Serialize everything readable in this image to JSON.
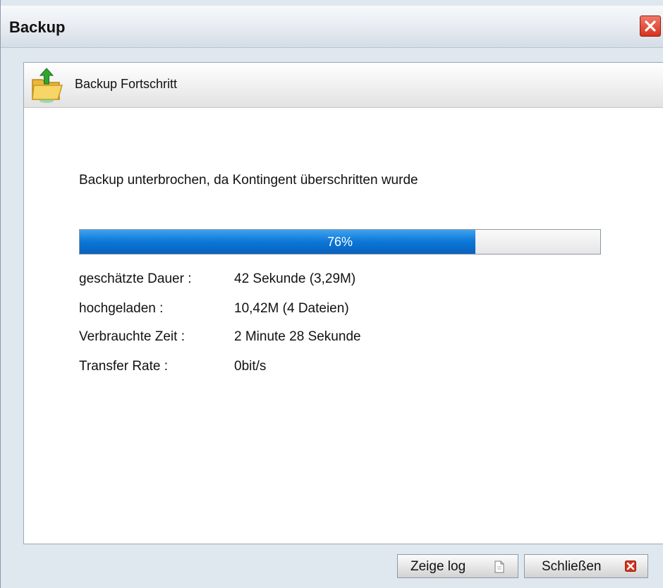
{
  "window": {
    "title": "Backup",
    "close_icon": "close-icon"
  },
  "panel": {
    "header": {
      "icon": "folder-upload-icon",
      "title": "Backup Fortschritt"
    },
    "message": "Backup unterbrochen, da Kontingent überschritten wurde",
    "progress": {
      "percent": 76,
      "label": "76%",
      "fill_color": "#0b76d8"
    },
    "info": {
      "estimated_duration": {
        "label": "geschätzte Dauer :",
        "value": "42 Sekunde (3,29M)"
      },
      "uploaded": {
        "label": "hochgeladen :",
        "value": "10,42M (4 Dateien)"
      },
      "elapsed_time": {
        "label": "Verbrauchte Zeit :",
        "value": "2 Minute 28 Sekunde"
      },
      "transfer_rate": {
        "label": "Transfer Rate :",
        "value": "0bit/s"
      }
    }
  },
  "buttons": {
    "show_log": {
      "label": "Zeige log",
      "icon": "document-icon"
    },
    "close": {
      "label": "Schließen",
      "icon": "close-red-icon"
    }
  },
  "colors": {
    "accent": "#0b76d8",
    "close_red": "#d8321d"
  }
}
